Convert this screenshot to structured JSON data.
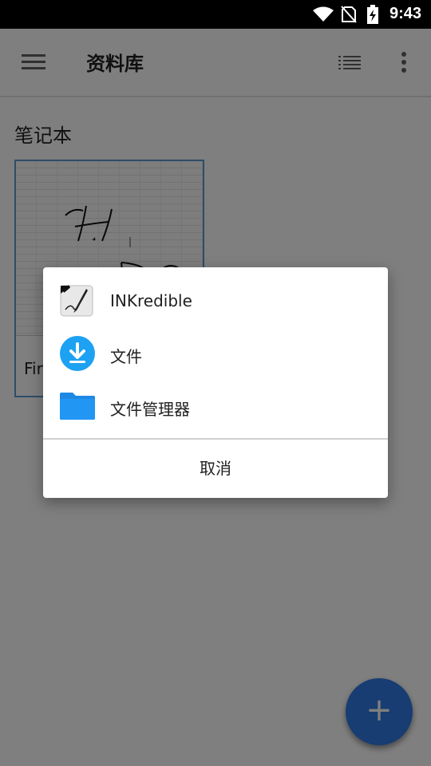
{
  "status_bar": {
    "time": "9:43"
  },
  "app_bar": {
    "title": "资料库"
  },
  "library": {
    "section_title": "笔记本",
    "notebooks": [
      {
        "label": "Fir"
      }
    ]
  },
  "fab": {
    "label": "+"
  },
  "chooser": {
    "items": [
      {
        "label": "INKredible",
        "icon": "inkredible-app-icon"
      },
      {
        "label": "文件",
        "icon": "download-icon"
      },
      {
        "label": "文件管理器",
        "icon": "folder-icon"
      }
    ],
    "cancel_label": "取消"
  },
  "colors": {
    "accent": "#2f7be4",
    "card_border": "#5b9bd5",
    "files_blue": "#1da1f2",
    "folder_blue": "#1e88e5"
  }
}
